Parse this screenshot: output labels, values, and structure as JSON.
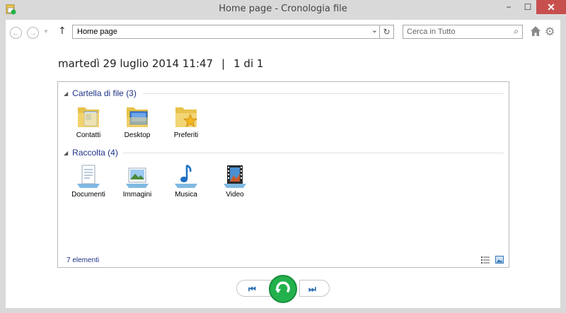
{
  "window": {
    "title": "Home page - Cronologia file",
    "minimize": "−",
    "maximize": "☐",
    "close": "✕"
  },
  "nav": {
    "address_value": "Home page",
    "search_placeholder": "Cerca in Tutto"
  },
  "snapshot": {
    "datetime": "martedì 29 luglio 2014 11:47",
    "separator": "|",
    "position": "1 di 1"
  },
  "groups": [
    {
      "title": "Cartella di file (3)",
      "items": [
        {
          "label": "Contatti",
          "icon": "contacts-folder-icon"
        },
        {
          "label": "Desktop",
          "icon": "desktop-folder-icon"
        },
        {
          "label": "Preferiti",
          "icon": "favorites-folder-icon"
        }
      ]
    },
    {
      "title": "Raccolta (4)",
      "items": [
        {
          "label": "Documenti",
          "icon": "documents-library-icon"
        },
        {
          "label": "Immagini",
          "icon": "pictures-library-icon"
        },
        {
          "label": "Musica",
          "icon": "music-library-icon"
        },
        {
          "label": "Video",
          "icon": "videos-library-icon"
        }
      ]
    }
  ],
  "status": {
    "count": "7 elementi"
  },
  "colors": {
    "accent_blue": "#1e3287",
    "close_red": "#c7504f",
    "restore_green": "#22b14c"
  }
}
